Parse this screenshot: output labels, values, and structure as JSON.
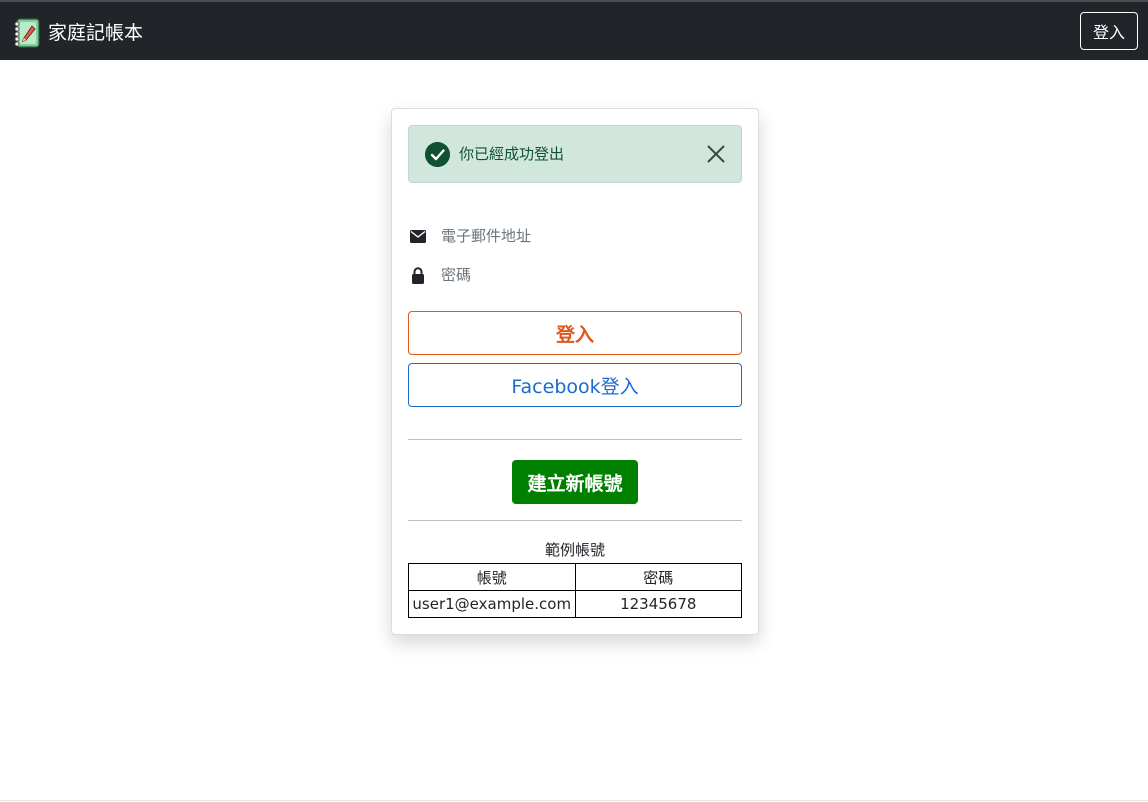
{
  "header": {
    "brand_name": "家庭記帳本",
    "login_label": "登入",
    "logo_icon": "notebook-pen-icon"
  },
  "alert": {
    "message": "你已經成功登出",
    "icon": "check-circle-icon",
    "close_icon": "close-icon",
    "color": "#0f5132",
    "background": "#d1e7dd"
  },
  "form": {
    "email_placeholder": "電子郵件地址",
    "email_value": "",
    "email_icon": "envelope-icon",
    "password_placeholder": "密碼",
    "password_value": "",
    "password_icon": "lock-icon",
    "login_label": "登入",
    "facebook_label": "Facebook登入",
    "register_label": "建立新帳號"
  },
  "sample": {
    "title": "範例帳號",
    "columns": [
      "帳號",
      "密碼"
    ],
    "rows": [
      [
        "user1@example.com",
        "12345678"
      ]
    ]
  },
  "colors": {
    "navbar": "#212529",
    "login_accent": "#e0561b",
    "facebook_accent": "#1c6bcf",
    "register_bg": "#008000"
  }
}
